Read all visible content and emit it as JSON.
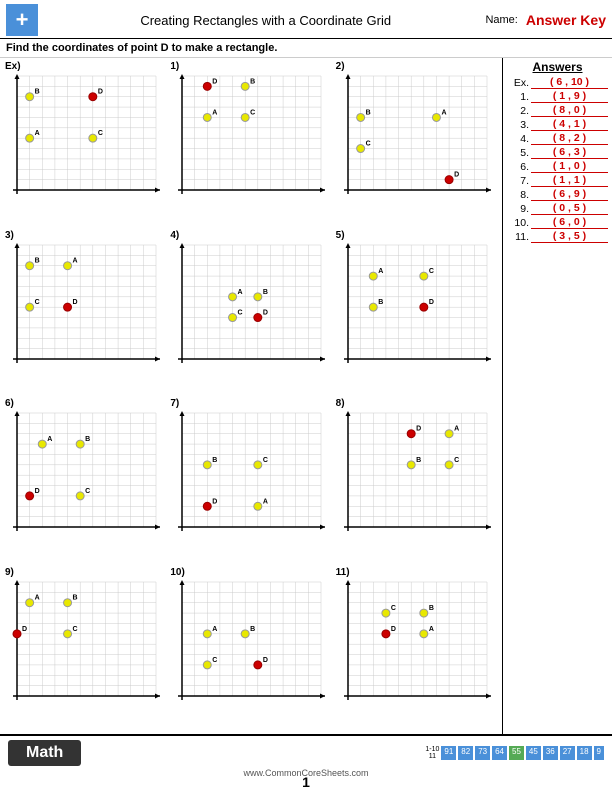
{
  "header": {
    "title": "Creating Rectangles with a Coordinate Grid",
    "name_label": "Name:",
    "answer_key": "Answer Key"
  },
  "instructions": "Find the coordinates of point D to make a rectangle.",
  "answers": {
    "title": "Answers",
    "items": [
      {
        "num": "Ex.",
        "val": "( 6 , 10 )"
      },
      {
        "num": "1.",
        "val": "( 1 , 9 )"
      },
      {
        "num": "2.",
        "val": "( 8 , 0 )"
      },
      {
        "num": "3.",
        "val": "( 4 , 1 )"
      },
      {
        "num": "4.",
        "val": "( 8 , 2 )"
      },
      {
        "num": "5.",
        "val": "( 6 , 3 )"
      },
      {
        "num": "6.",
        "val": "( 1 , 0 )"
      },
      {
        "num": "7.",
        "val": "( 1 , 1 )"
      },
      {
        "num": "8.",
        "val": "( 6 , 9 )"
      },
      {
        "num": "9.",
        "val": "( 0 , 5 )"
      },
      {
        "num": "10.",
        "val": "( 6 , 0 )"
      },
      {
        "num": "11.",
        "val": "( 3 , 5 )"
      }
    ]
  },
  "footer": {
    "math_label": "Math",
    "url": "www.CommonCoreSheets.com",
    "page": "1",
    "stats_1_10": "1-10",
    "stats_vals": "91 82 73 64",
    "stats_55": "55",
    "stats_cols": "45 36 27 18 9"
  },
  "problems": [
    {
      "id": "ex",
      "label": "Ex)",
      "points": [
        {
          "name": "B",
          "x": 1,
          "y": 9,
          "color": "yellow"
        },
        {
          "name": "D",
          "x": 6,
          "y": 9,
          "color": "red"
        },
        {
          "name": "A",
          "x": 1,
          "y": 5,
          "color": "yellow"
        },
        {
          "name": "C",
          "x": 6,
          "y": 5,
          "color": "yellow"
        }
      ]
    },
    {
      "id": "p1",
      "label": "1)",
      "points": [
        {
          "name": "D",
          "x": 2,
          "y": 10,
          "color": "red"
        },
        {
          "name": "B",
          "x": 5,
          "y": 10,
          "color": "yellow"
        },
        {
          "name": "A",
          "x": 2,
          "y": 7,
          "color": "yellow"
        },
        {
          "name": "C",
          "x": 5,
          "y": 7,
          "color": "yellow"
        }
      ]
    },
    {
      "id": "p2",
      "label": "2)",
      "points": [
        {
          "name": "B",
          "x": 1,
          "y": 7,
          "color": "yellow"
        },
        {
          "name": "A",
          "x": 7,
          "y": 7,
          "color": "yellow"
        },
        {
          "name": "C",
          "x": 1,
          "y": 4,
          "color": "yellow"
        },
        {
          "name": "D",
          "x": 8,
          "y": 1,
          "color": "red"
        }
      ]
    },
    {
      "id": "p3",
      "label": "3)",
      "points": [
        {
          "name": "B",
          "x": 1,
          "y": 9,
          "color": "yellow"
        },
        {
          "name": "A",
          "x": 4,
          "y": 9,
          "color": "yellow"
        },
        {
          "name": "C",
          "x": 1,
          "y": 5,
          "color": "yellow"
        },
        {
          "name": "D",
          "x": 4,
          "y": 5,
          "color": "red"
        }
      ]
    },
    {
      "id": "p4",
      "label": "4)",
      "points": [
        {
          "name": "A",
          "x": 4,
          "y": 6,
          "color": "yellow"
        },
        {
          "name": "B",
          "x": 6,
          "y": 6,
          "color": "yellow"
        },
        {
          "name": "C",
          "x": 4,
          "y": 4,
          "color": "yellow"
        },
        {
          "name": "D",
          "x": 6,
          "y": 4,
          "color": "red"
        }
      ]
    },
    {
      "id": "p5",
      "label": "5)",
      "points": [
        {
          "name": "A",
          "x": 2,
          "y": 8,
          "color": "yellow"
        },
        {
          "name": "C",
          "x": 6,
          "y": 8,
          "color": "yellow"
        },
        {
          "name": "B",
          "x": 2,
          "y": 5,
          "color": "yellow"
        },
        {
          "name": "D",
          "x": 6,
          "y": 5,
          "color": "red"
        }
      ]
    },
    {
      "id": "p6",
      "label": "6)",
      "points": [
        {
          "name": "A",
          "x": 2,
          "y": 8,
          "color": "yellow"
        },
        {
          "name": "B",
          "x": 5,
          "y": 8,
          "color": "yellow"
        },
        {
          "name": "D",
          "x": 1,
          "y": 3,
          "color": "red"
        },
        {
          "name": "C",
          "x": 5,
          "y": 3,
          "color": "yellow"
        }
      ]
    },
    {
      "id": "p7",
      "label": "7)",
      "points": [
        {
          "name": "B",
          "x": 2,
          "y": 6,
          "color": "yellow"
        },
        {
          "name": "C",
          "x": 6,
          "y": 6,
          "color": "yellow"
        },
        {
          "name": "D",
          "x": 2,
          "y": 2,
          "color": "red"
        },
        {
          "name": "A",
          "x": 6,
          "y": 2,
          "color": "yellow"
        }
      ]
    },
    {
      "id": "p8",
      "label": "8)",
      "points": [
        {
          "name": "D",
          "x": 5,
          "y": 9,
          "color": "red"
        },
        {
          "name": "A",
          "x": 8,
          "y": 9,
          "color": "yellow"
        },
        {
          "name": "B",
          "x": 5,
          "y": 6,
          "color": "yellow"
        },
        {
          "name": "C",
          "x": 8,
          "y": 6,
          "color": "yellow"
        }
      ]
    },
    {
      "id": "p9",
      "label": "9)",
      "points": [
        {
          "name": "A",
          "x": 1,
          "y": 9,
          "color": "yellow"
        },
        {
          "name": "B",
          "x": 4,
          "y": 9,
          "color": "yellow"
        },
        {
          "name": "D",
          "x": 0,
          "y": 6,
          "color": "red"
        },
        {
          "name": "C",
          "x": 4,
          "y": 6,
          "color": "yellow"
        }
      ]
    },
    {
      "id": "p10",
      "label": "10)",
      "points": [
        {
          "name": "A",
          "x": 2,
          "y": 6,
          "color": "yellow"
        },
        {
          "name": "B",
          "x": 5,
          "y": 6,
          "color": "yellow"
        },
        {
          "name": "C",
          "x": 2,
          "y": 3,
          "color": "yellow"
        },
        {
          "name": "D",
          "x": 6,
          "y": 3,
          "color": "red"
        }
      ]
    },
    {
      "id": "p11",
      "label": "11)",
      "points": [
        {
          "name": "C",
          "x": 3,
          "y": 8,
          "color": "yellow"
        },
        {
          "name": "B",
          "x": 6,
          "y": 8,
          "color": "yellow"
        },
        {
          "name": "D",
          "x": 3,
          "y": 6,
          "color": "red"
        },
        {
          "name": "A",
          "x": 6,
          "y": 6,
          "color": "yellow"
        }
      ]
    }
  ]
}
